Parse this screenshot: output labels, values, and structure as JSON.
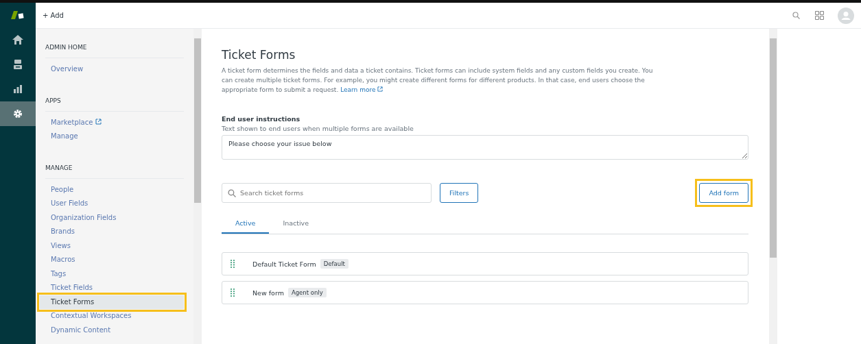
{
  "topbar": {
    "add_label": "+ Add"
  },
  "nav_rail": [
    {
      "kind": "home",
      "selected": false
    },
    {
      "kind": "tickets",
      "selected": false
    },
    {
      "kind": "reports",
      "selected": false
    },
    {
      "kind": "settings",
      "selected": true
    }
  ],
  "sidebar": {
    "sections": [
      {
        "heading": "ADMIN HOME",
        "items": [
          {
            "label": "Overview",
            "selected": false,
            "external": false,
            "highlighted": false
          }
        ]
      },
      {
        "heading": "APPS",
        "items": [
          {
            "label": "Marketplace",
            "selected": false,
            "external": true,
            "highlighted": false
          },
          {
            "label": "Manage",
            "selected": false,
            "external": false,
            "highlighted": false
          }
        ]
      },
      {
        "heading": "MANAGE",
        "items": [
          {
            "label": "People",
            "selected": false,
            "external": false,
            "highlighted": false
          },
          {
            "label": "User Fields",
            "selected": false,
            "external": false,
            "highlighted": false
          },
          {
            "label": "Organization Fields",
            "selected": false,
            "external": false,
            "highlighted": false
          },
          {
            "label": "Brands",
            "selected": false,
            "external": false,
            "highlighted": false
          },
          {
            "label": "Views",
            "selected": false,
            "external": false,
            "highlighted": false
          },
          {
            "label": "Macros",
            "selected": false,
            "external": false,
            "highlighted": false
          },
          {
            "label": "Tags",
            "selected": false,
            "external": false,
            "highlighted": false
          },
          {
            "label": "Ticket Fields",
            "selected": false,
            "external": false,
            "highlighted": false
          },
          {
            "label": "Ticket Forms",
            "selected": true,
            "external": false,
            "highlighted": true
          },
          {
            "label": "Contextual Workspaces",
            "selected": false,
            "external": false,
            "highlighted": false
          },
          {
            "label": "Dynamic Content",
            "selected": false,
            "external": false,
            "highlighted": false
          }
        ]
      }
    ]
  },
  "page": {
    "title": "Ticket Forms",
    "description": "A ticket form determines the fields and data a ticket contains. Ticket forms can include system fields and any custom fields you create. You can create multiple ticket forms. For example, you might create different forms for different products. In that case, end users choose the appropriate form to submit a request.",
    "learn_more": "Learn more",
    "instructions_label": "End user instructions",
    "instructions_hint": "Text shown to end users when multiple forms are available",
    "instructions_value": "Please choose your issue below",
    "search_placeholder": "Search ticket forms",
    "filters_button": "Filters",
    "add_button": {
      "label": "Add form",
      "highlighted": true
    },
    "tabs": [
      {
        "label": "Active",
        "selected": true
      },
      {
        "label": "Inactive",
        "selected": false
      }
    ],
    "forms": [
      {
        "name": "Default Ticket Form",
        "badge": "Default"
      },
      {
        "name": "New form",
        "badge": "Agent only"
      }
    ]
  }
}
